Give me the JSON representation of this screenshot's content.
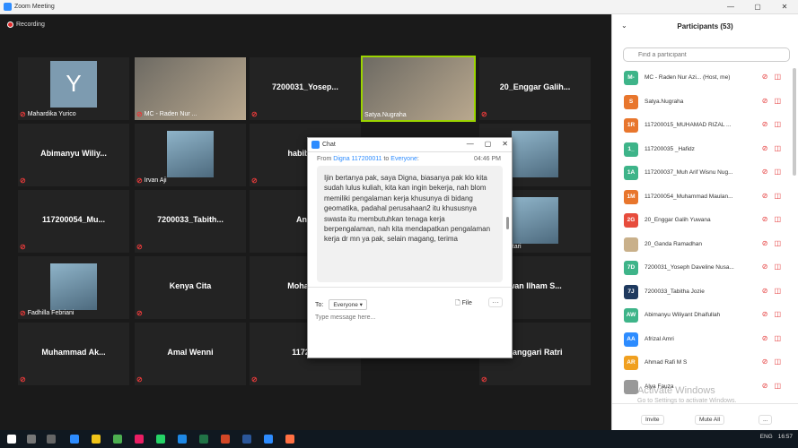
{
  "window": {
    "title": "Zoom Meeting",
    "controls": [
      "—",
      "▢",
      "✕"
    ]
  },
  "recording": "Recording",
  "tiles": [
    {
      "name": "Mahardika Yurico",
      "avatar": "Y",
      "type": "avatar",
      "muted": true
    },
    {
      "name": "MC - Raden Nur ...",
      "type": "video",
      "muted": true
    },
    {
      "name": "7200031_Yosep...",
      "type": "text",
      "muted": true
    },
    {
      "name": "Satya.Nugraha",
      "type": "video",
      "active": true,
      "muted": false
    },
    {
      "name": "20_Enggar Galih...",
      "type": "text",
      "muted": true
    },
    {
      "name": "Abimanyu  Wiliy...",
      "type": "text",
      "muted": true
    },
    {
      "name": "Irvan Aji",
      "type": "photo",
      "muted": true
    },
    {
      "name": "habib aly",
      "type": "text",
      "muted": true
    },
    {
      "name": "",
      "type": "hidden",
      "muted": false
    },
    {
      "name": "amelia",
      "type": "photo",
      "muted": true
    },
    {
      "name": "117200054_Mu...",
      "type": "text",
      "muted": true
    },
    {
      "name": "7200033_Tabith...",
      "type": "text",
      "muted": true
    },
    {
      "name": "Anbi",
      "type": "text",
      "muted": false
    },
    {
      "name": "",
      "type": "hidden",
      "muted": false
    },
    {
      "name": "itina Lestari",
      "type": "photo",
      "muted": true
    },
    {
      "name": "Fadhilla Febriani",
      "type": "photo",
      "muted": true
    },
    {
      "name": "Kenya Cita",
      "type": "text",
      "muted": true
    },
    {
      "name": "Mohamm",
      "type": "text",
      "muted": false
    },
    {
      "name": "",
      "type": "hidden",
      "muted": false
    },
    {
      "name": "wan  Ilham  S...",
      "type": "text",
      "muted": true
    },
    {
      "name": "Muhammad  Ak...",
      "type": "text",
      "muted": true
    },
    {
      "name": "Amal Wenni",
      "type": "text",
      "muted": true
    },
    {
      "name": "117200",
      "type": "text",
      "muted": true
    },
    {
      "name": "",
      "type": "hidden",
      "muted": false
    },
    {
      "name": "nanggari Ratri",
      "type": "text",
      "muted": true
    }
  ],
  "chat": {
    "title": "Chat",
    "from_prefix": "From",
    "sender": "Digna 117200011",
    "to_word": "to",
    "recipient": "Everyone",
    "time": "04:46 PM",
    "message": "Ijin bertanya pak, saya Digna, biasanya pak klo kita sudah lulus kuliah, kita kan ingin bekerja, nah blom memiliki pengalaman kerja khusunya di bidang geomatika, padahal perusahaan2 itu khususnya swasta  itu membutuhkan tenaga kerja berpengalaman, nah kita mendapatkan pengalaman kerja dr mn ya pak, selain magang, terima",
    "to_label": "To:",
    "to_value": "Everyone",
    "file_label": "File",
    "placeholder": "Type message here..."
  },
  "participants": {
    "title": "Participants (53)",
    "search_placeholder": "Find a participant",
    "list": [
      {
        "initials": "M-",
        "name": "MC - Raden Nur Azi... (Host, me)",
        "color": "#3eb489"
      },
      {
        "initials": "S",
        "name": "Satya.Nugraha",
        "color": "#e8762d"
      },
      {
        "initials": "1R",
        "name": "117200015_MUHAMAD RIZAL ...",
        "color": "#e8762d"
      },
      {
        "initials": "1_",
        "name": "117200035 _Hafidz",
        "color": "#3eb489"
      },
      {
        "initials": "1A",
        "name": "117200037_Muh Arif Wisnu Nug...",
        "color": "#3eb489"
      },
      {
        "initials": "1M",
        "name": "117200054_Muhammad Maulan...",
        "color": "#e8762d"
      },
      {
        "initials": "2G",
        "name": "20_Enggar Galih Yuwana",
        "color": "#e74c3c"
      },
      {
        "initials": "",
        "name": "20_Ganda Ramadhan",
        "color": "#c9b08a"
      },
      {
        "initials": "7D",
        "name": "7200031_Yoseph Daveline Nusa...",
        "color": "#3eb489"
      },
      {
        "initials": "7J",
        "name": "7200033_Tabitha Jozie",
        "color": "#1f3a5f"
      },
      {
        "initials": "AW",
        "name": "Abimanyu Wiliyant Dhaifullah",
        "color": "#3eb489"
      },
      {
        "initials": "AA",
        "name": "Afrizal Amri",
        "color": "#2d8cff"
      },
      {
        "initials": "AR",
        "name": "Ahmad Rafi M S",
        "color": "#f0a020"
      },
      {
        "initials": "",
        "name": "Alya Fauza",
        "color": "#999999"
      }
    ],
    "invite": "Invite",
    "mute_all": "Mute All",
    "more": "..."
  },
  "watermark": {
    "line1": "Activate Windows",
    "line2": "Go to Settings to activate Windows."
  },
  "tray": {
    "lang": "ENG",
    "time": "16:57"
  }
}
